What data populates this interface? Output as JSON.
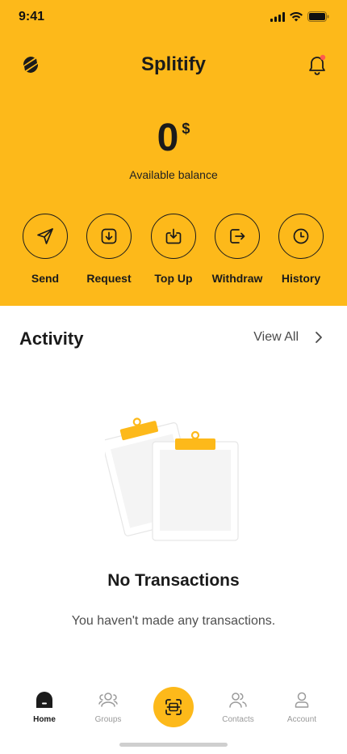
{
  "status_bar": {
    "time": "9:41"
  },
  "header": {
    "title": "Splitify",
    "background_color": "#fdb91a",
    "notification_dot_color": "#ff5a4e"
  },
  "balance": {
    "amount": "0",
    "currency": "$",
    "label": "Available balance"
  },
  "actions": [
    {
      "label": "Send",
      "icon": "send-icon"
    },
    {
      "label": "Request",
      "icon": "request-icon"
    },
    {
      "label": "Top Up",
      "icon": "top-up-icon"
    },
    {
      "label": "Withdraw",
      "icon": "withdraw-icon"
    },
    {
      "label": "History",
      "icon": "history-icon"
    }
  ],
  "activity": {
    "title": "Activity",
    "view_all_label": "View All",
    "empty_title": "No Transactions",
    "empty_subtitle": "You haven't made any transactions."
  },
  "bottom_nav": {
    "items": [
      {
        "label": "Home",
        "icon": "home-icon",
        "active": true
      },
      {
        "label": "Groups",
        "icon": "groups-icon",
        "active": false
      },
      {
        "label": "",
        "icon": "scan-icon",
        "active": false
      },
      {
        "label": "Contacts",
        "icon": "contacts-icon",
        "active": false
      },
      {
        "label": "Account",
        "icon": "account-icon",
        "active": false
      }
    ]
  }
}
